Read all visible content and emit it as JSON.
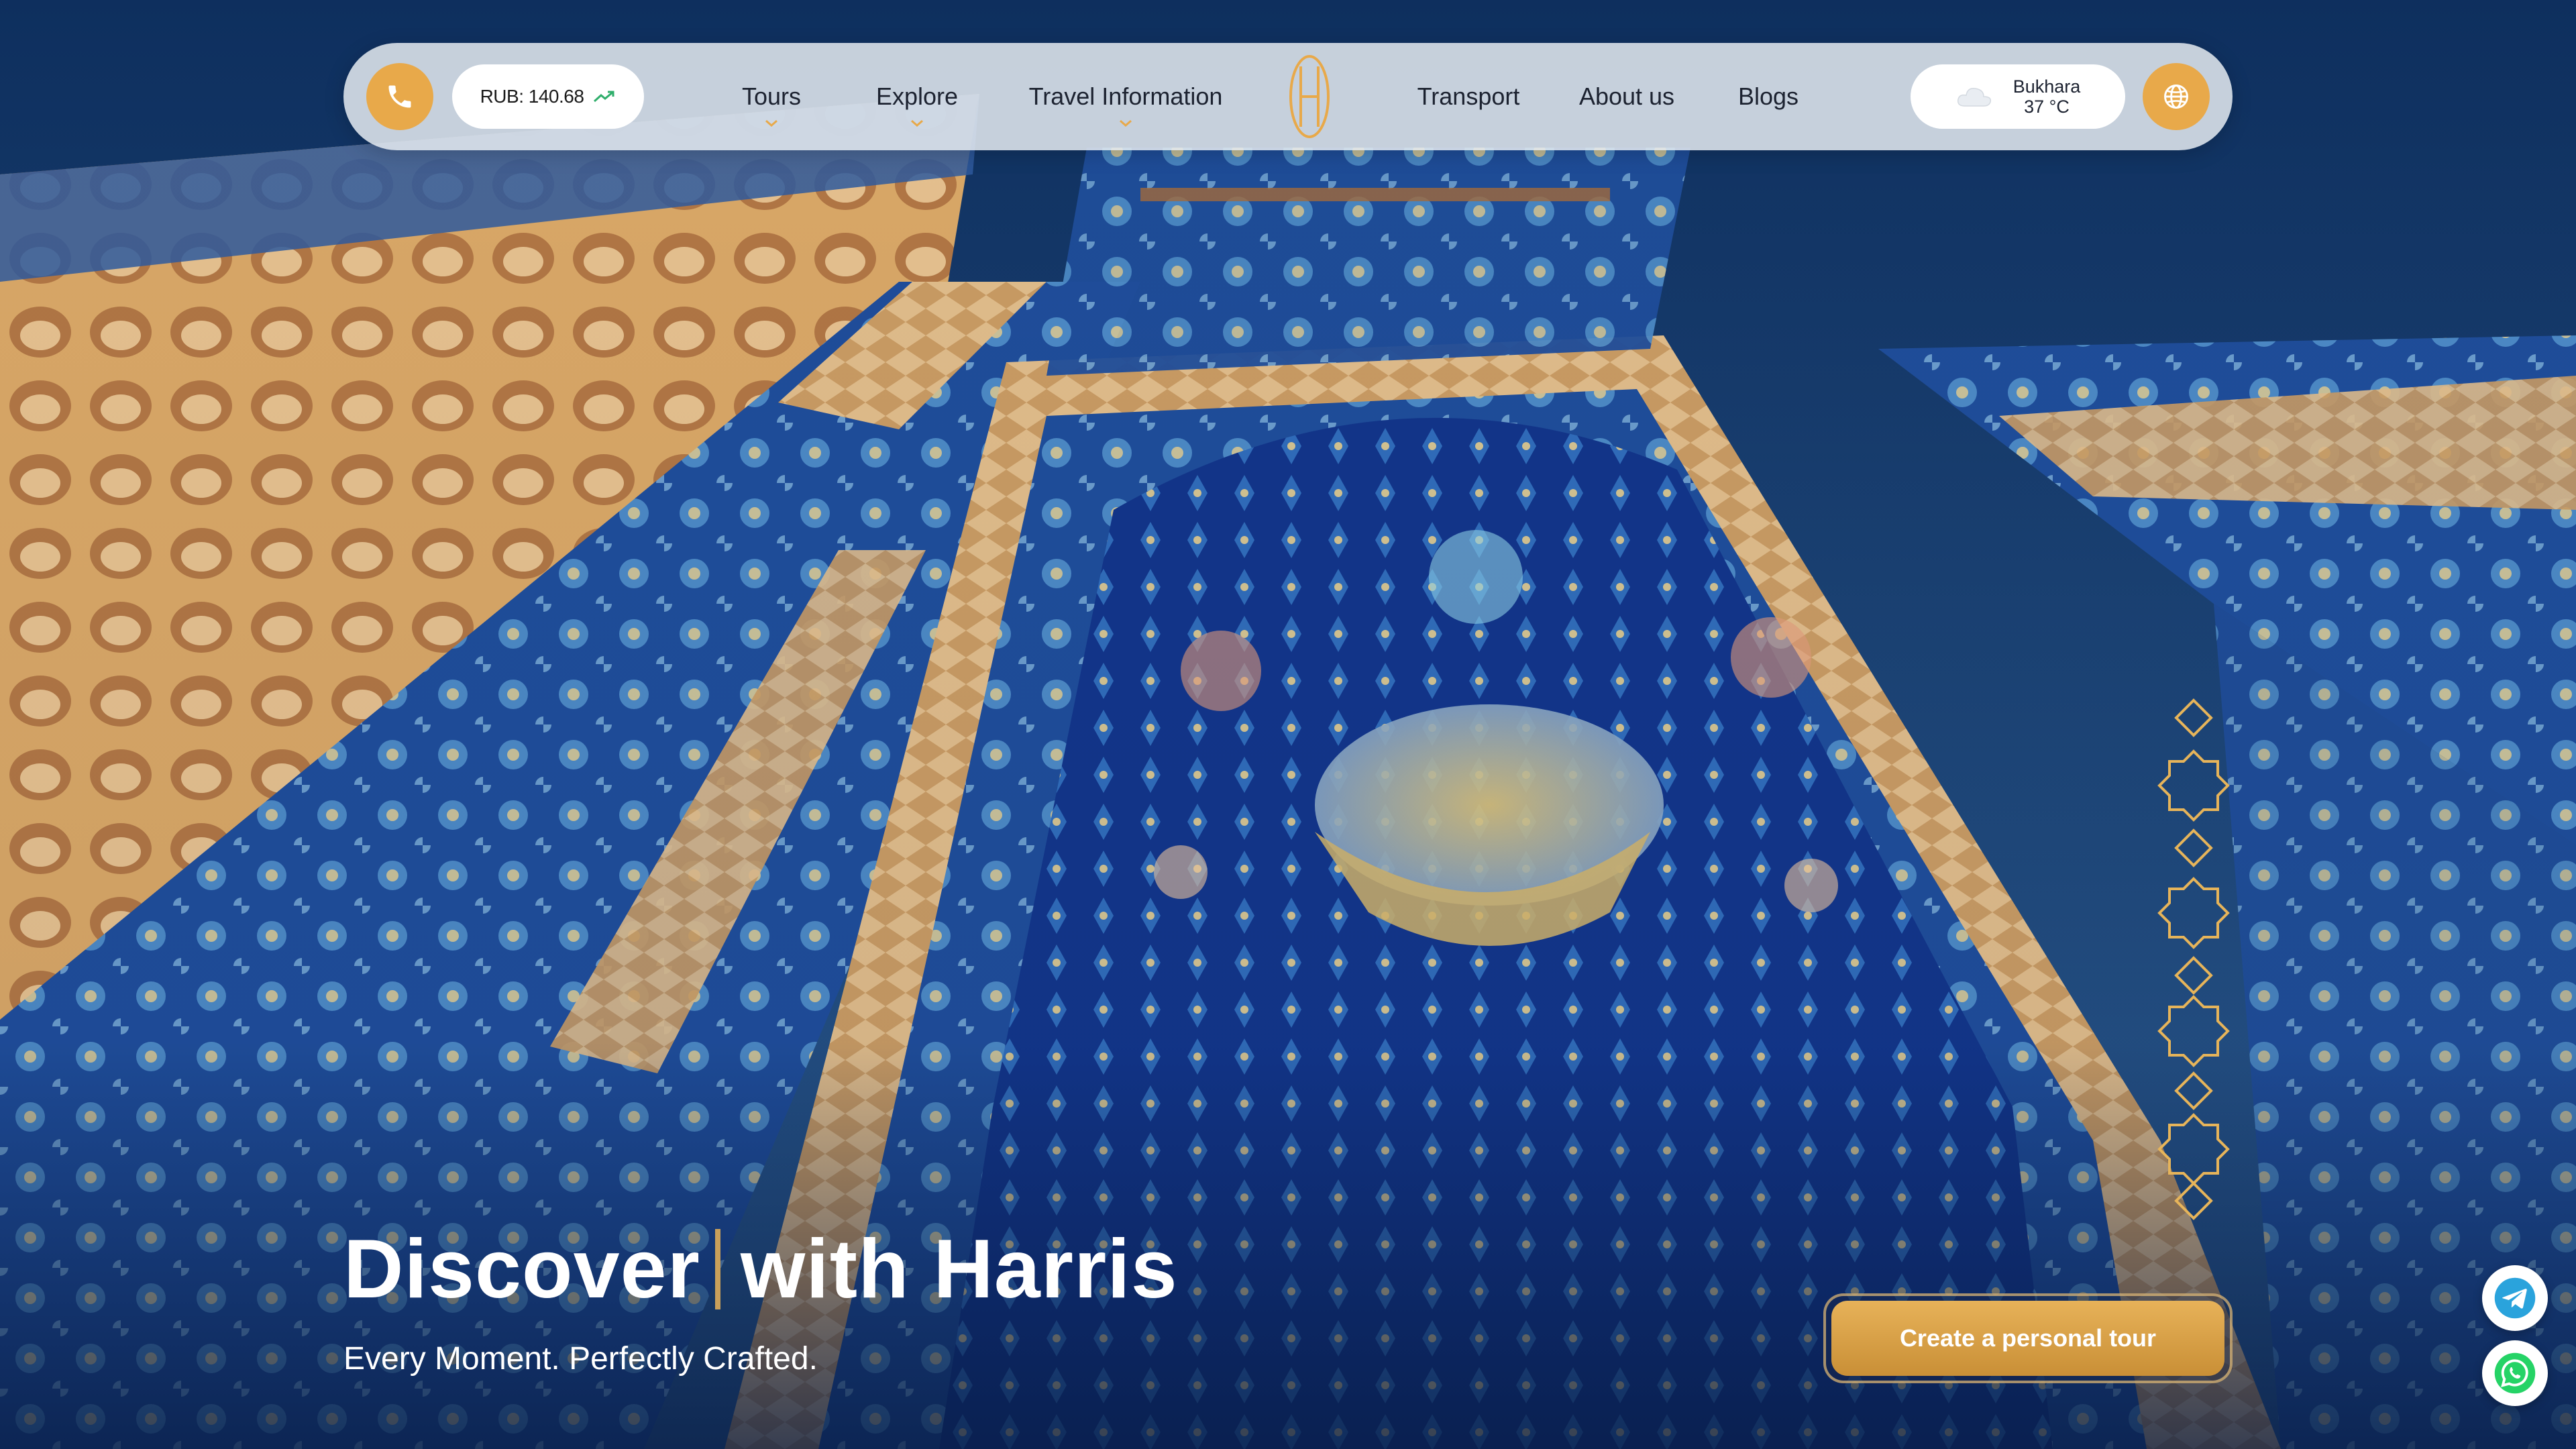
{
  "nav": {
    "rate_label": "RUB: 140.68",
    "links": [
      "Tours",
      "Explore",
      "Travel Information",
      "Transport",
      "About us",
      "Blogs"
    ],
    "weather": {
      "city": "Bukhara",
      "temp": "37 °C"
    }
  },
  "hero": {
    "title_part1": "Discover",
    "title_part2": "with Harris",
    "subtitle": "Every Moment. Perfectly Crafted.",
    "cta_label": "Create a personal tour"
  },
  "icons": [
    "phone-icon",
    "trend-up-icon",
    "chevron-down-icon",
    "harris-logo",
    "cloud-icon",
    "globe-icon",
    "telegram-icon",
    "whatsapp-icon"
  ],
  "colors": {
    "accent": "#e8a94a",
    "nav_bg": "#e4eaf0",
    "telegram": "#2aa3dc",
    "whatsapp": "#25d366"
  }
}
